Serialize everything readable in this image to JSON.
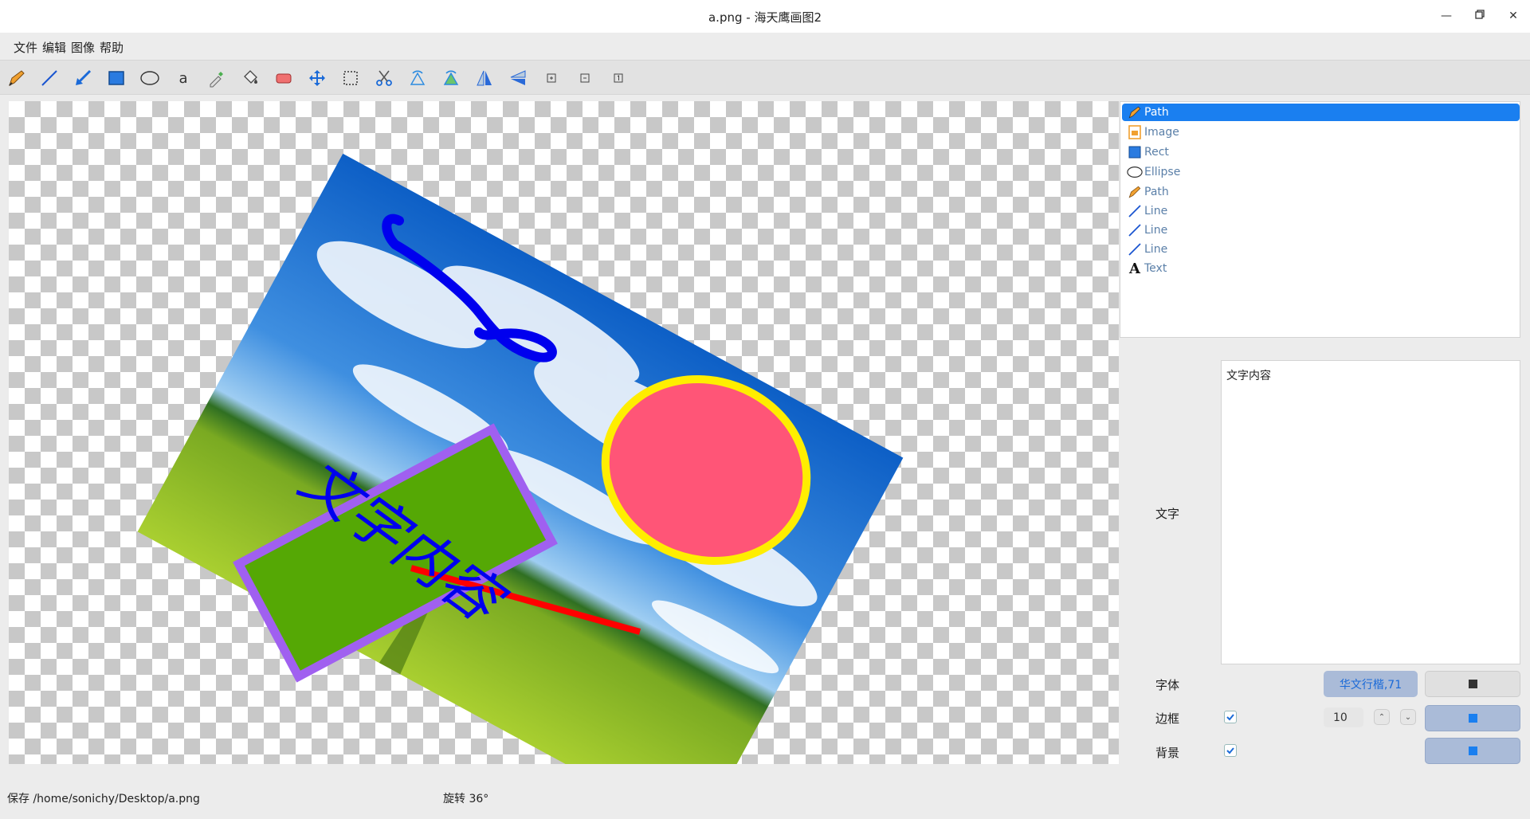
{
  "window": {
    "title": "a.png - 海天鹰画图2"
  },
  "menu": [
    "文件",
    "编辑",
    "图像",
    "帮助"
  ],
  "toolbar": [
    {
      "icon": "pencil-icon"
    },
    {
      "icon": "line-icon"
    },
    {
      "icon": "arrow-icon"
    },
    {
      "icon": "rect-icon"
    },
    {
      "icon": "ellipse-icon"
    },
    {
      "icon": "text-icon",
      "glyph": "a"
    },
    {
      "icon": "color-picker-icon"
    },
    {
      "icon": "fill-bucket-icon"
    },
    {
      "icon": "eraser-icon"
    },
    {
      "icon": "move-icon"
    },
    {
      "icon": "select-rect-icon"
    },
    {
      "icon": "cut-icon"
    },
    {
      "icon": "rotate-left-icon"
    },
    {
      "icon": "rotate-right-icon"
    },
    {
      "icon": "flip-horizontal-icon"
    },
    {
      "icon": "flip-vertical-icon"
    },
    {
      "icon": "zoom-in-icon"
    },
    {
      "icon": "zoom-out-icon"
    },
    {
      "icon": "actual-size-icon"
    }
  ],
  "layers": [
    {
      "label": "Path",
      "icon": "pencil-icon",
      "selected": true
    },
    {
      "label": "Image",
      "icon": "image-icon"
    },
    {
      "label": "Rect",
      "icon": "rect-icon"
    },
    {
      "label": "Ellipse",
      "icon": "ellipse-icon"
    },
    {
      "label": "Path",
      "icon": "pencil-icon"
    },
    {
      "label": "Line",
      "icon": "line-icon"
    },
    {
      "label": "Line",
      "icon": "line-icon"
    },
    {
      "label": "Line",
      "icon": "line-icon"
    },
    {
      "label": "Text",
      "icon": "text-icon"
    }
  ],
  "props": {
    "text_label": "文字",
    "text_value": "文字内容",
    "font_label": "字体",
    "font_value": "华文行楷,71",
    "border_label": "边框",
    "border_checked": true,
    "border_width": "10",
    "background_label": "背景",
    "background_checked": true
  },
  "canvas": {
    "rotation_text": "文字内容",
    "colors": {
      "rect_fill": "#55a805",
      "rect_border": "#a060f0",
      "ellipse_fill": "#ff5577",
      "ellipse_border": "#ffee00",
      "path": "#0000ee",
      "line": "#ff0000"
    }
  },
  "status": {
    "save": "保存 /home/sonichy/Desktop/a.png",
    "rotation": "旋转 36°"
  },
  "colors": {
    "accent": "#1a7ff0",
    "swatch_bg": "#aabbd8"
  }
}
